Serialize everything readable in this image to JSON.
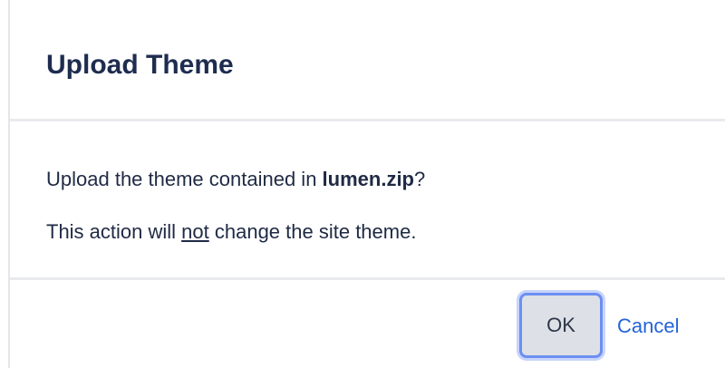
{
  "dialog": {
    "title": "Upload Theme",
    "message": {
      "prefix": "Upload the theme contained in ",
      "filename": "lumen.zip",
      "suffix": "?"
    },
    "note": {
      "prefix": "This action will ",
      "emphasis": "not",
      "suffix": " change the site theme."
    },
    "buttons": {
      "ok_label": "OK",
      "cancel_label": "Cancel"
    }
  },
  "colors": {
    "title": "#1e2c4f",
    "text": "#1f2a44",
    "link": "#2463dc",
    "ok_focus_ring": "#6d8ff2",
    "ok_background": "#dde1e7",
    "divider": "#e8eaed"
  }
}
